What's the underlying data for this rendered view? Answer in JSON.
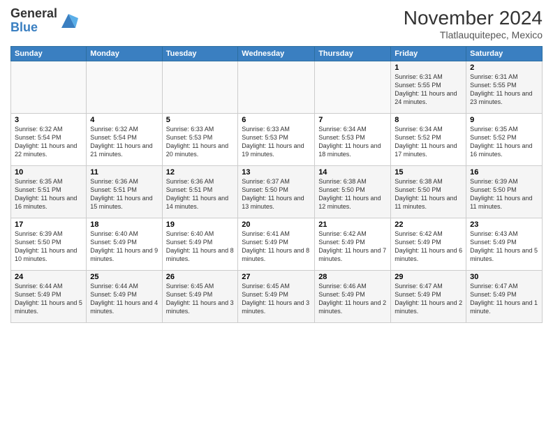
{
  "logo": {
    "line1": "General",
    "line2": "Blue"
  },
  "header": {
    "month": "November 2024",
    "location": "Tlatlauquitepec, Mexico"
  },
  "weekdays": [
    "Sunday",
    "Monday",
    "Tuesday",
    "Wednesday",
    "Thursday",
    "Friday",
    "Saturday"
  ],
  "weeks": [
    [
      {
        "day": "",
        "info": ""
      },
      {
        "day": "",
        "info": ""
      },
      {
        "day": "",
        "info": ""
      },
      {
        "day": "",
        "info": ""
      },
      {
        "day": "",
        "info": ""
      },
      {
        "day": "1",
        "info": "Sunrise: 6:31 AM\nSunset: 5:55 PM\nDaylight: 11 hours and 24 minutes."
      },
      {
        "day": "2",
        "info": "Sunrise: 6:31 AM\nSunset: 5:55 PM\nDaylight: 11 hours and 23 minutes."
      }
    ],
    [
      {
        "day": "3",
        "info": "Sunrise: 6:32 AM\nSunset: 5:54 PM\nDaylight: 11 hours and 22 minutes."
      },
      {
        "day": "4",
        "info": "Sunrise: 6:32 AM\nSunset: 5:54 PM\nDaylight: 11 hours and 21 minutes."
      },
      {
        "day": "5",
        "info": "Sunrise: 6:33 AM\nSunset: 5:53 PM\nDaylight: 11 hours and 20 minutes."
      },
      {
        "day": "6",
        "info": "Sunrise: 6:33 AM\nSunset: 5:53 PM\nDaylight: 11 hours and 19 minutes."
      },
      {
        "day": "7",
        "info": "Sunrise: 6:34 AM\nSunset: 5:53 PM\nDaylight: 11 hours and 18 minutes."
      },
      {
        "day": "8",
        "info": "Sunrise: 6:34 AM\nSunset: 5:52 PM\nDaylight: 11 hours and 17 minutes."
      },
      {
        "day": "9",
        "info": "Sunrise: 6:35 AM\nSunset: 5:52 PM\nDaylight: 11 hours and 16 minutes."
      }
    ],
    [
      {
        "day": "10",
        "info": "Sunrise: 6:35 AM\nSunset: 5:51 PM\nDaylight: 11 hours and 16 minutes."
      },
      {
        "day": "11",
        "info": "Sunrise: 6:36 AM\nSunset: 5:51 PM\nDaylight: 11 hours and 15 minutes."
      },
      {
        "day": "12",
        "info": "Sunrise: 6:36 AM\nSunset: 5:51 PM\nDaylight: 11 hours and 14 minutes."
      },
      {
        "day": "13",
        "info": "Sunrise: 6:37 AM\nSunset: 5:50 PM\nDaylight: 11 hours and 13 minutes."
      },
      {
        "day": "14",
        "info": "Sunrise: 6:38 AM\nSunset: 5:50 PM\nDaylight: 11 hours and 12 minutes."
      },
      {
        "day": "15",
        "info": "Sunrise: 6:38 AM\nSunset: 5:50 PM\nDaylight: 11 hours and 11 minutes."
      },
      {
        "day": "16",
        "info": "Sunrise: 6:39 AM\nSunset: 5:50 PM\nDaylight: 11 hours and 11 minutes."
      }
    ],
    [
      {
        "day": "17",
        "info": "Sunrise: 6:39 AM\nSunset: 5:50 PM\nDaylight: 11 hours and 10 minutes."
      },
      {
        "day": "18",
        "info": "Sunrise: 6:40 AM\nSunset: 5:49 PM\nDaylight: 11 hours and 9 minutes."
      },
      {
        "day": "19",
        "info": "Sunrise: 6:40 AM\nSunset: 5:49 PM\nDaylight: 11 hours and 8 minutes."
      },
      {
        "day": "20",
        "info": "Sunrise: 6:41 AM\nSunset: 5:49 PM\nDaylight: 11 hours and 8 minutes."
      },
      {
        "day": "21",
        "info": "Sunrise: 6:42 AM\nSunset: 5:49 PM\nDaylight: 11 hours and 7 minutes."
      },
      {
        "day": "22",
        "info": "Sunrise: 6:42 AM\nSunset: 5:49 PM\nDaylight: 11 hours and 6 minutes."
      },
      {
        "day": "23",
        "info": "Sunrise: 6:43 AM\nSunset: 5:49 PM\nDaylight: 11 hours and 5 minutes."
      }
    ],
    [
      {
        "day": "24",
        "info": "Sunrise: 6:44 AM\nSunset: 5:49 PM\nDaylight: 11 hours and 5 minutes."
      },
      {
        "day": "25",
        "info": "Sunrise: 6:44 AM\nSunset: 5:49 PM\nDaylight: 11 hours and 4 minutes."
      },
      {
        "day": "26",
        "info": "Sunrise: 6:45 AM\nSunset: 5:49 PM\nDaylight: 11 hours and 3 minutes."
      },
      {
        "day": "27",
        "info": "Sunrise: 6:45 AM\nSunset: 5:49 PM\nDaylight: 11 hours and 3 minutes."
      },
      {
        "day": "28",
        "info": "Sunrise: 6:46 AM\nSunset: 5:49 PM\nDaylight: 11 hours and 2 minutes."
      },
      {
        "day": "29",
        "info": "Sunrise: 6:47 AM\nSunset: 5:49 PM\nDaylight: 11 hours and 2 minutes."
      },
      {
        "day": "30",
        "info": "Sunrise: 6:47 AM\nSunset: 5:49 PM\nDaylight: 11 hours and 1 minute."
      }
    ]
  ]
}
